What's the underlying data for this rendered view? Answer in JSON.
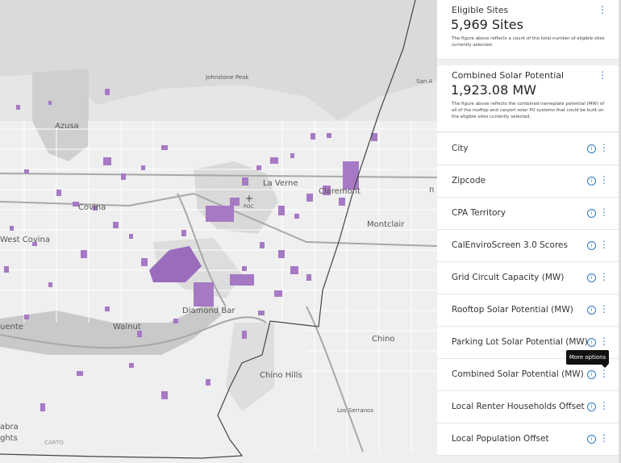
{
  "map": {
    "labels": {
      "johnstone_peak": "Johnstone Peak",
      "azusa": "Azusa",
      "la_verne": "La Verne",
      "claremont": "Claremont",
      "covina": "Covina",
      "poc": "POC",
      "west_covina": "West Covina",
      "montclair": "Montclair",
      "diamond_bar": "Diamond Bar",
      "walnut": "Walnut",
      "chino": "Chino",
      "chino_hills": "Chino Hills",
      "los_serranos": "Los Serranos",
      "labra": "abra",
      "heights": "ghts",
      "uente": "uente",
      "san_a": "San A",
      "pomona_partial": "n",
      "carto": "CARTO"
    },
    "colors": {
      "land": "#e6e6e6",
      "hills": "#d6d6d6",
      "urban": "#f0f0f0",
      "roads": "#ffffff",
      "sites": "#a679c4",
      "sites_dark": "#8f62b0",
      "boundary": "#444444",
      "freeway": "#9a9a9a"
    }
  },
  "panel": {
    "eligible_sites": {
      "title": "Eligible Sites",
      "value": "5,969 Sites",
      "description": "The figure above reflects a count of the total number of eligible sites currently selected."
    },
    "combined_solar": {
      "title": "Combined Solar Potential",
      "value": "1,923.08 MW",
      "description": "The figure above reflects the combined nameplate potential (MW) of all of the rooftop and carport solar PV systems that could be built on the eligible sites currently selected."
    },
    "filters": [
      {
        "label": "City"
      },
      {
        "label": "Zipcode"
      },
      {
        "label": "CPA Territory"
      },
      {
        "label": "CalEnviroScreen 3.0 Scores"
      },
      {
        "label": "Grid Circuit Capacity (MW)"
      },
      {
        "label": "Rooftop Solar Potential (MW)"
      },
      {
        "label": "Parking Lot Solar Potential (MW)"
      },
      {
        "label": "Combined Solar Potential (MW)"
      },
      {
        "label": "Local Renter Households Offset"
      },
      {
        "label": "Local Population Offset"
      }
    ],
    "icons": {
      "info": "info-icon",
      "more": "more-options-icon"
    }
  },
  "tooltip": {
    "text": "More options"
  }
}
